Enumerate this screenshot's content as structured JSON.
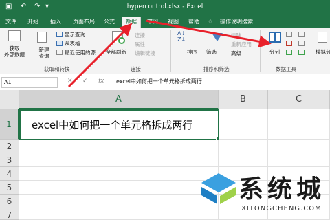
{
  "titlebar": {
    "save_icon": "save-icon",
    "undo_icon": "undo-icon",
    "redo_icon": "redo-icon",
    "customize_icon": "customize-qat-icon",
    "title": "hypercontrol.xlsx  -  Excel"
  },
  "tabs": [
    {
      "label": "文件"
    },
    {
      "label": "开始"
    },
    {
      "label": "插入"
    },
    {
      "label": "页面布局"
    },
    {
      "label": "公式"
    },
    {
      "label": "数据"
    },
    {
      "label": "审阅"
    },
    {
      "label": "视图"
    },
    {
      "label": "帮助"
    },
    {
      "label": "操作说明搜索"
    }
  ],
  "ribbon": {
    "get_external_data": "获取\n外部数据",
    "new_query": "新建\n查询",
    "show_queries": "显示查询",
    "from_table": "从表格",
    "recent_sources": "最近使用的源",
    "group_get_transform": "获取和转换",
    "refresh_all": "全部刷新",
    "connections": "连接",
    "properties": "属性",
    "edit_links": "编辑链接",
    "group_connections": "连接",
    "sort": "排序",
    "filter": "筛选",
    "clear": "清除",
    "reapply": "重新应用",
    "advanced": "高级",
    "group_sort_filter": "排序和筛选",
    "text_to_columns": "分列",
    "group_data_tools": "数据工具",
    "what_if": "模拟分"
  },
  "formula_bar": {
    "name_box": "A1",
    "cancel": "✕",
    "enter": "✓",
    "fx": "fx",
    "content": "excel中如何把一个单元格拆成两行"
  },
  "grid": {
    "columns": [
      "A",
      "B",
      "C"
    ],
    "rows": [
      "1",
      "2",
      "3",
      "4",
      "5",
      "6",
      "7"
    ],
    "a1_value": "excel中如何把一个单元格拆成两行"
  },
  "watermark": {
    "brand": "系统城",
    "url": "XITONGCHENG.COM"
  },
  "colors": {
    "excel_green": "#217346",
    "arrow_red": "#e8202a",
    "ribbon_bg": "#f3f3f3"
  }
}
